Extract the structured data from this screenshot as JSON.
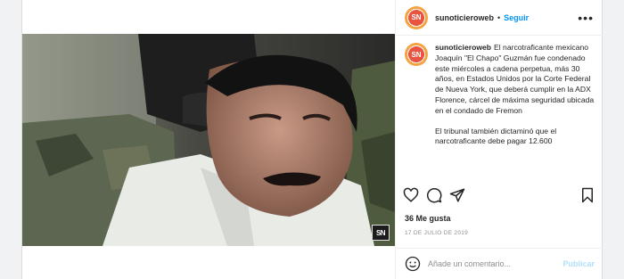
{
  "post": {
    "username": "sunoticieroweb",
    "avatar_text": "SN",
    "follow_label": "Seguir",
    "separator": "•",
    "more_label": "•••",
    "image_watermark": "SN",
    "caption_paragraphs": [
      "El narcotraficante mexicano Joaquín \"El Chapo\" Guzmán fue condenado este miércoles a cadena perpetua, más 30 años, en Estados Unidos por la Corte Federal de Nueva York, que deberá cumplir en la ADX Florence, cárcel de máxima seguridad ubicada en el condado de Fremon",
      "El tribunal también dictaminó que el narcotraficante debe pagar 12.600"
    ],
    "likes": "36 Me gusta",
    "date": "17 DE JULIO DE 2019",
    "comment_placeholder": "Añade un comentario...",
    "publish_label": "Publicar"
  },
  "icons": {
    "like": "heart-icon",
    "comment": "comment-icon",
    "share": "share-icon",
    "save": "bookmark-icon",
    "emoji": "emoji-icon"
  }
}
